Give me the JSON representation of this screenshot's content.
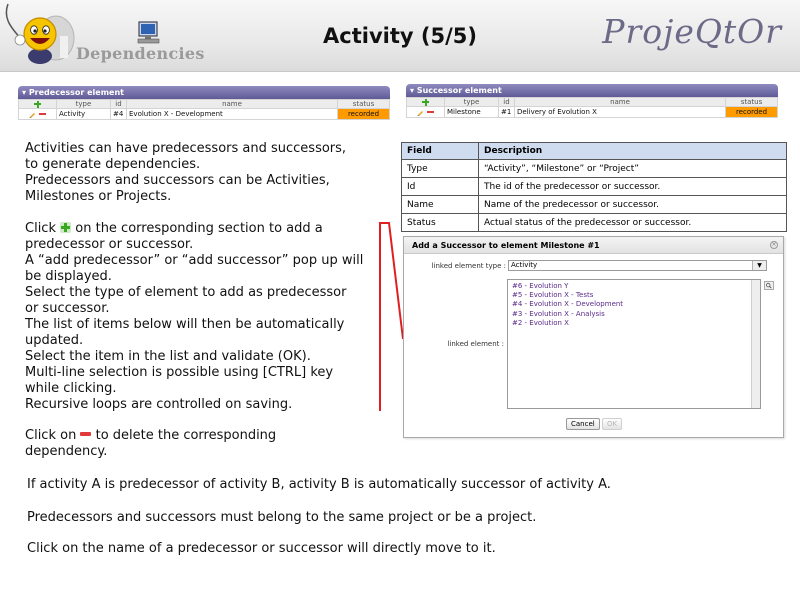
{
  "header": {
    "subtitle": "Dependencies",
    "title": "Activity (5/5)",
    "brand": "ProjeQtOr"
  },
  "predecessor_panel": {
    "title": "Predecessor element",
    "columns": [
      "type",
      "id",
      "name",
      "status"
    ],
    "row": {
      "type": "Activity",
      "id": "#4",
      "name": "Evolution X - Development",
      "status": "recorded"
    }
  },
  "successor_panel": {
    "title": "Successor element",
    "columns": [
      "type",
      "id",
      "name",
      "status"
    ],
    "row": {
      "type": "Milestone",
      "id": "#1",
      "name": "Delivery of Evolution X",
      "status": "recorded"
    }
  },
  "status_color": "#ff9a00",
  "intro": [
    "Activities can have predecessors and successors,",
    "to generate dependencies.",
    "Predecessors and successors can be Activities,",
    "Milestones or Projects."
  ],
  "add_help": {
    "click_prefix": "Click",
    "click_suffix": "on the corresponding section to add a",
    "lines": [
      "predecessor or successor.",
      "A “add predecessor” or “add successor” pop up will",
      "be displayed.",
      "Select the type of element to add as predecessor",
      "or successor.",
      "The list of items below will then be automatically",
      "updated.",
      "Select the item in the list and validate (OK).",
      "Multi-line selection is possible using [CTRL] key",
      "while clicking.",
      "Recursive loops are controlled on saving."
    ]
  },
  "delete_help": {
    "click_prefix": "Click on",
    "click_suffix": "to delete the corresponding",
    "line2": "dependency."
  },
  "notes": [
    "If activity A is predecessor of activity B, activity B is automatically successor of activity A.",
    "Predecessors and successors must belong to the same project or be a project.",
    "Click on the name of a predecessor or successor will directly move to it."
  ],
  "field_table": {
    "headers": [
      "Field",
      "Description"
    ],
    "rows": [
      [
        "Type",
        "“Activity”, “Milestone” or “Project”"
      ],
      [
        "Id",
        "The id of the predecessor or successor."
      ],
      [
        "Name",
        "Name of the predecessor or successor."
      ],
      [
        "Status",
        "Actual status of the predecessor or successor."
      ]
    ]
  },
  "dialog": {
    "title": "Add a Successor to element Milestone #1",
    "type_label": "linked element type :",
    "type_value": "Activity",
    "element_label": "linked element :",
    "items": [
      "#6 - Evolution Y",
      "#5 - Evolution X - Tests",
      "#4 - Evolution X - Development",
      "#3 - Evolution X - Analysis",
      "#2 - Evolution X"
    ],
    "cancel_label": "Cancel",
    "ok_label": "OK"
  },
  "icons": [
    "mascot-icon",
    "computer-icon",
    "plus-icon",
    "minus-icon",
    "pencil-icon",
    "close-icon",
    "dropdown-arrow-icon",
    "search-icon"
  ]
}
